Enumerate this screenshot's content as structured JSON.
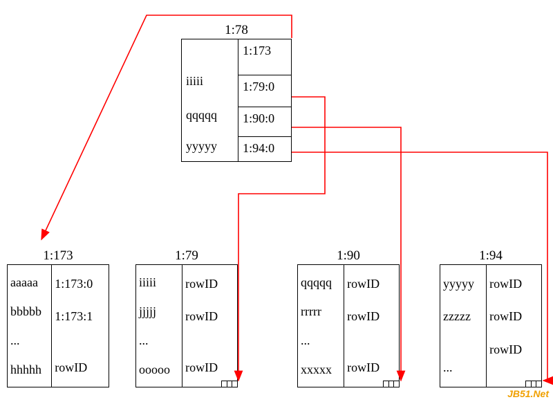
{
  "root_node": {
    "title": "1:78",
    "rows": [
      {
        "left": "",
        "right": "1:173"
      },
      {
        "left": "iiiii",
        "right": "1:79:0"
      },
      {
        "left": "qqqqq",
        "right": "1:90:0"
      },
      {
        "left": "yyyyy",
        "right": "1:94:0"
      }
    ]
  },
  "child_nodes": [
    {
      "title": "1:173",
      "rows": [
        {
          "left": "aaaaa",
          "right": "1:173:0"
        },
        {
          "left": "bbbbb",
          "right": "1:173:1"
        },
        {
          "left": "...",
          "right": ""
        },
        {
          "left": "hhhhh",
          "right": "rowID"
        }
      ],
      "tabmark": false
    },
    {
      "title": "1:79",
      "rows": [
        {
          "left": "iiiii",
          "right": "rowID"
        },
        {
          "left": "jjjjj",
          "right": "rowID"
        },
        {
          "left": "...",
          "right": ""
        },
        {
          "left": "ooooo",
          "right": "rowID"
        }
      ],
      "tabmark": true
    },
    {
      "title": "1:90",
      "rows": [
        {
          "left": "qqqqq",
          "right": "rowID"
        },
        {
          "left": "rrrrr",
          "right": "rowID"
        },
        {
          "left": "...",
          "right": ""
        },
        {
          "left": "xxxxx",
          "right": "rowID"
        }
      ],
      "tabmark": true
    },
    {
      "title": "1:94",
      "rows": [
        {
          "left": "yyyyy",
          "right": "rowID"
        },
        {
          "left": "zzzzz",
          "right": "rowID"
        },
        {
          "left": "",
          "right": "rowID"
        },
        {
          "left": "...",
          "right": ""
        }
      ],
      "tabmark": true
    }
  ],
  "watermark": "JB51.Net",
  "arrow_color": "#ff0000"
}
